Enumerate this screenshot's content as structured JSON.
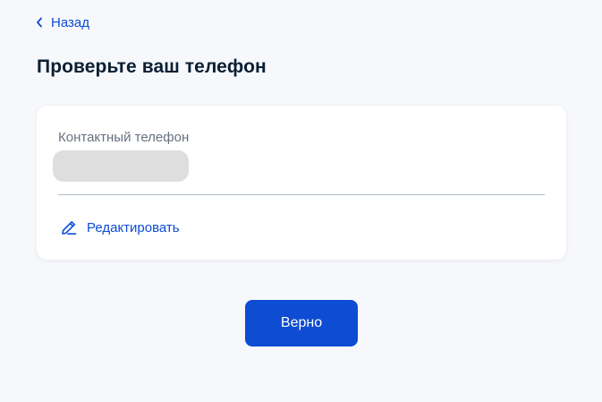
{
  "header": {
    "back_label": "Назад",
    "title": "Проверьте ваш телефон"
  },
  "contact": {
    "label": "Контактный телефон",
    "value_masked": true,
    "edit_label": "Редактировать"
  },
  "actions": {
    "confirm_label": "Верно"
  },
  "icons": {
    "back": "chevron-left-icon",
    "edit": "pencil-icon"
  },
  "colors": {
    "accent": "#0d4cd3",
    "background": "#f6f8fb",
    "card": "#ffffff",
    "text": "#0b1f33",
    "muted_text": "#66727f",
    "mask": "#dedede"
  }
}
